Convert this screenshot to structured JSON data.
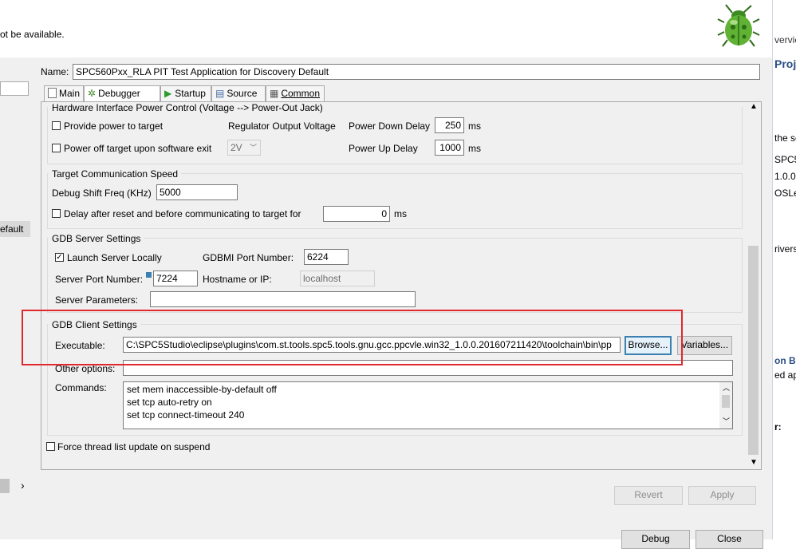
{
  "header": {
    "message": "ot be available."
  },
  "left_panel": {
    "selected_item": "efault",
    "arrow": "›"
  },
  "config": {
    "name_label": "Name:",
    "name_value": "SPC560Pxx_RLA PIT Test Application for Discovery Default"
  },
  "tabs": [
    {
      "label": "Main",
      "icon": "main-icon"
    },
    {
      "label": "Debugger",
      "icon": "debug-bug-icon"
    },
    {
      "label": "Startup",
      "icon": "play-icon"
    },
    {
      "label": "Source",
      "icon": "source-icon"
    },
    {
      "label": "Common",
      "icon": "common-icon"
    }
  ],
  "power": {
    "group_label": "Hardware Interface Power Control (Voltage --> Power-Out Jack)",
    "provide_power_label": "Provide power to target",
    "regulator_label": "Regulator Output Voltage",
    "power_down_label": "Power Down Delay",
    "power_down_value": "250",
    "ms1": "ms",
    "power_off_label": "Power off target upon software exit",
    "regulator_value": "2V",
    "power_up_label": "Power Up Delay",
    "power_up_value": "1000",
    "ms2": "ms"
  },
  "comm": {
    "group_label": "Target Communication Speed",
    "shift_label": "Debug Shift Freq (KHz)",
    "shift_value": "5000",
    "delay_label": "Delay after reset and before communicating to target for",
    "delay_value": "0",
    "ms": "ms"
  },
  "gdb_server": {
    "group_label": "GDB Server Settings",
    "launch_label": "Launch Server Locally",
    "launch_checked": "✓",
    "gdbmi_label": "GDBMI Port Number:",
    "gdbmi_value": "6224",
    "server_port_label": "Server Port Number:",
    "server_port_value": "7224",
    "hostname_label": "Hostname or IP:",
    "hostname_value": "localhost",
    "params_label": "Server Parameters:",
    "params_value": ""
  },
  "gdb_client": {
    "group_label": "GDB Client Settings",
    "executable_label": "Executable:",
    "executable_value": "C:\\SPC5Studio\\eclipse\\plugins\\com.st.tools.spc5.tools.gnu.gcc.ppcvle.win32_1.0.0.201607211420\\toolchain\\bin\\pp",
    "browse_label": "Browse...",
    "variables_label": "Variables...",
    "other_label": "Other options:",
    "other_value": "",
    "commands_label": "Commands:",
    "commands": [
      "set mem inaccessible-by-default off",
      "set tcp auto-retry on",
      "set tcp connect-timeout 240"
    ]
  },
  "force_label": "Force thread list update on suspend",
  "buttons": {
    "revert": "Revert",
    "apply": "Apply",
    "debug": "Debug",
    "close": "Close"
  },
  "right_panel": {
    "lines": [
      "verviev",
      "Proj",
      "the se",
      "SPC5",
      "1.0.0",
      "OSLe",
      "rivers",
      "on Bo",
      "ed ap",
      "r:"
    ]
  },
  "colors": {
    "highlight_red": "#e0282f",
    "focus_blue": "#3c7fb1"
  }
}
